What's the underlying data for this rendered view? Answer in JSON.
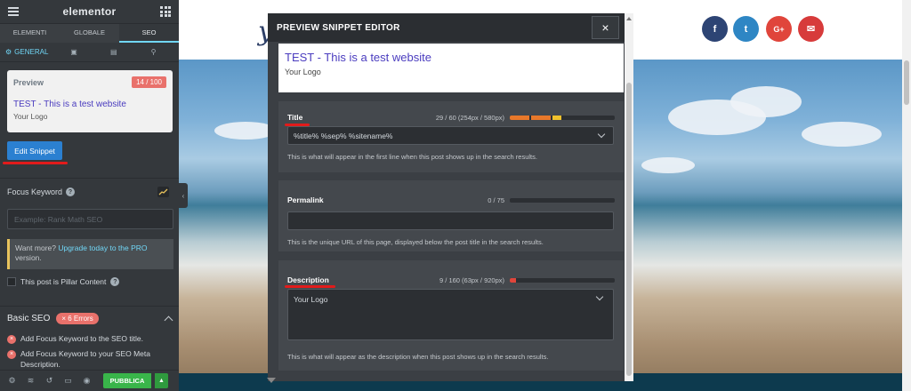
{
  "sidebar": {
    "app_name": "elementor",
    "tabs": [
      {
        "label": "ELEMENTI"
      },
      {
        "label": "GLOBALE"
      },
      {
        "label": "SEO"
      }
    ],
    "subtabs": {
      "general_label": "GENERAL"
    },
    "preview": {
      "label": "Preview",
      "score": "14 / 100",
      "title": "TEST - This is a test website",
      "url": "Your Logo"
    },
    "edit_snippet_label": "Edit Snippet",
    "focus_keyword": {
      "label": "Focus Keyword",
      "placeholder": "Example: Rank Math SEO"
    },
    "upgrade": {
      "prefix": "Want more? ",
      "link": "Upgrade today to the PRO",
      "suffix": " version."
    },
    "pillar_label": "This post is Pillar Content",
    "basic_seo": {
      "title": "Basic SEO",
      "errors_badge": "× 6 Errors",
      "items": [
        "Add Focus Keyword to the SEO title.",
        "Add Focus Keyword to your SEO Meta Description."
      ]
    },
    "publish_label": "PUBBLICA"
  },
  "modal": {
    "title": "PREVIEW SNIPPET EDITOR",
    "close_glyph": "×",
    "preview": {
      "title": "TEST - This is a test website",
      "url": "Your Logo"
    },
    "title_field": {
      "label": "Title",
      "count": "29 / 60 (254px / 580px)",
      "value": "%title% %sep% %sitename%",
      "help": "This is what will appear in the first line when this post shows up in the search results.",
      "meter_fraction": 0.48
    },
    "permalink_field": {
      "label": "Permalink",
      "count": "0 / 75",
      "value": "",
      "help": "This is the unique URL of this page, displayed below the post title in the search results.",
      "meter_fraction": 0
    },
    "description_field": {
      "label": "Description",
      "count": "9 / 160 (63px / 920px)",
      "value": "Your Logo",
      "help": "This is what will appear as the description when this post shows up in the search results.",
      "meter_fraction": 0.06
    }
  },
  "colors": {
    "accent": "#71d7f7",
    "preview_title": "#4a3cbf",
    "error": "#e9716b",
    "publish": "#39b54a",
    "annotation_red": "#e21b1b",
    "meter_orange": "#e8782a",
    "meter_yellow": "#f0c12c",
    "facebook": "#2d4474",
    "twitter": "#2e86c4",
    "google_plus": "#e0453b",
    "email": "#d73b3b"
  },
  "canvas": {
    "logo_glyph": "y",
    "social": [
      {
        "icon": "facebook-icon",
        "glyph": "f"
      },
      {
        "icon": "twitter-icon",
        "glyph": "t"
      },
      {
        "icon": "google-plus-icon",
        "glyph": "G+"
      },
      {
        "icon": "email-icon",
        "glyph": "✉"
      }
    ]
  }
}
